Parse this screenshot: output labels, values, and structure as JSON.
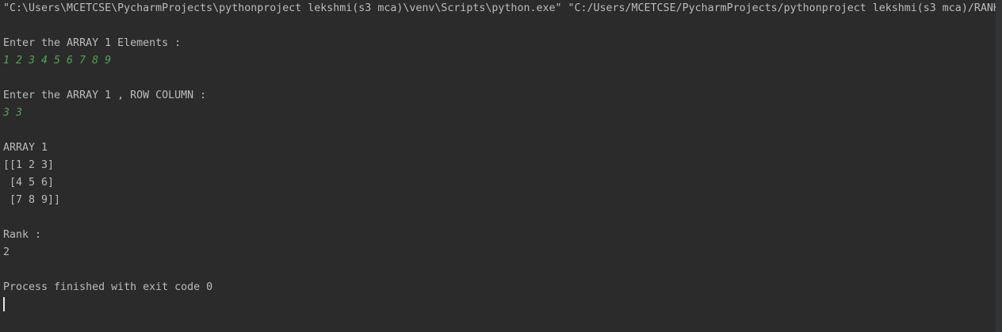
{
  "console": {
    "command_line": "\"C:\\Users\\MCETCSE\\PycharmProjects\\pythonproject lekshmi(s3 mca)\\venv\\Scripts\\python.exe\" \"C:/Users/MCETCSE/PycharmProjects/pythonproject lekshmi(s3 mca)/RANK",
    "prompt_array_elements": "Enter the ARRAY 1 Elements :",
    "input_array_elements": "1 2 3 4 5 6 7 8 9",
    "prompt_row_column": "Enter the ARRAY 1 , ROW COLUMN :",
    "input_row_column": "3 3",
    "array_title": "ARRAY 1",
    "array_rows": [
      "[[1 2 3]",
      " [4 5 6]",
      " [7 8 9]]"
    ],
    "rank_label": "Rank :",
    "rank_value": "2",
    "exit_message": "Process finished with exit code 0"
  },
  "colors": {
    "background": "#2b2b2b",
    "text": "#bbbbbb",
    "user_input": "#4ea64e"
  }
}
